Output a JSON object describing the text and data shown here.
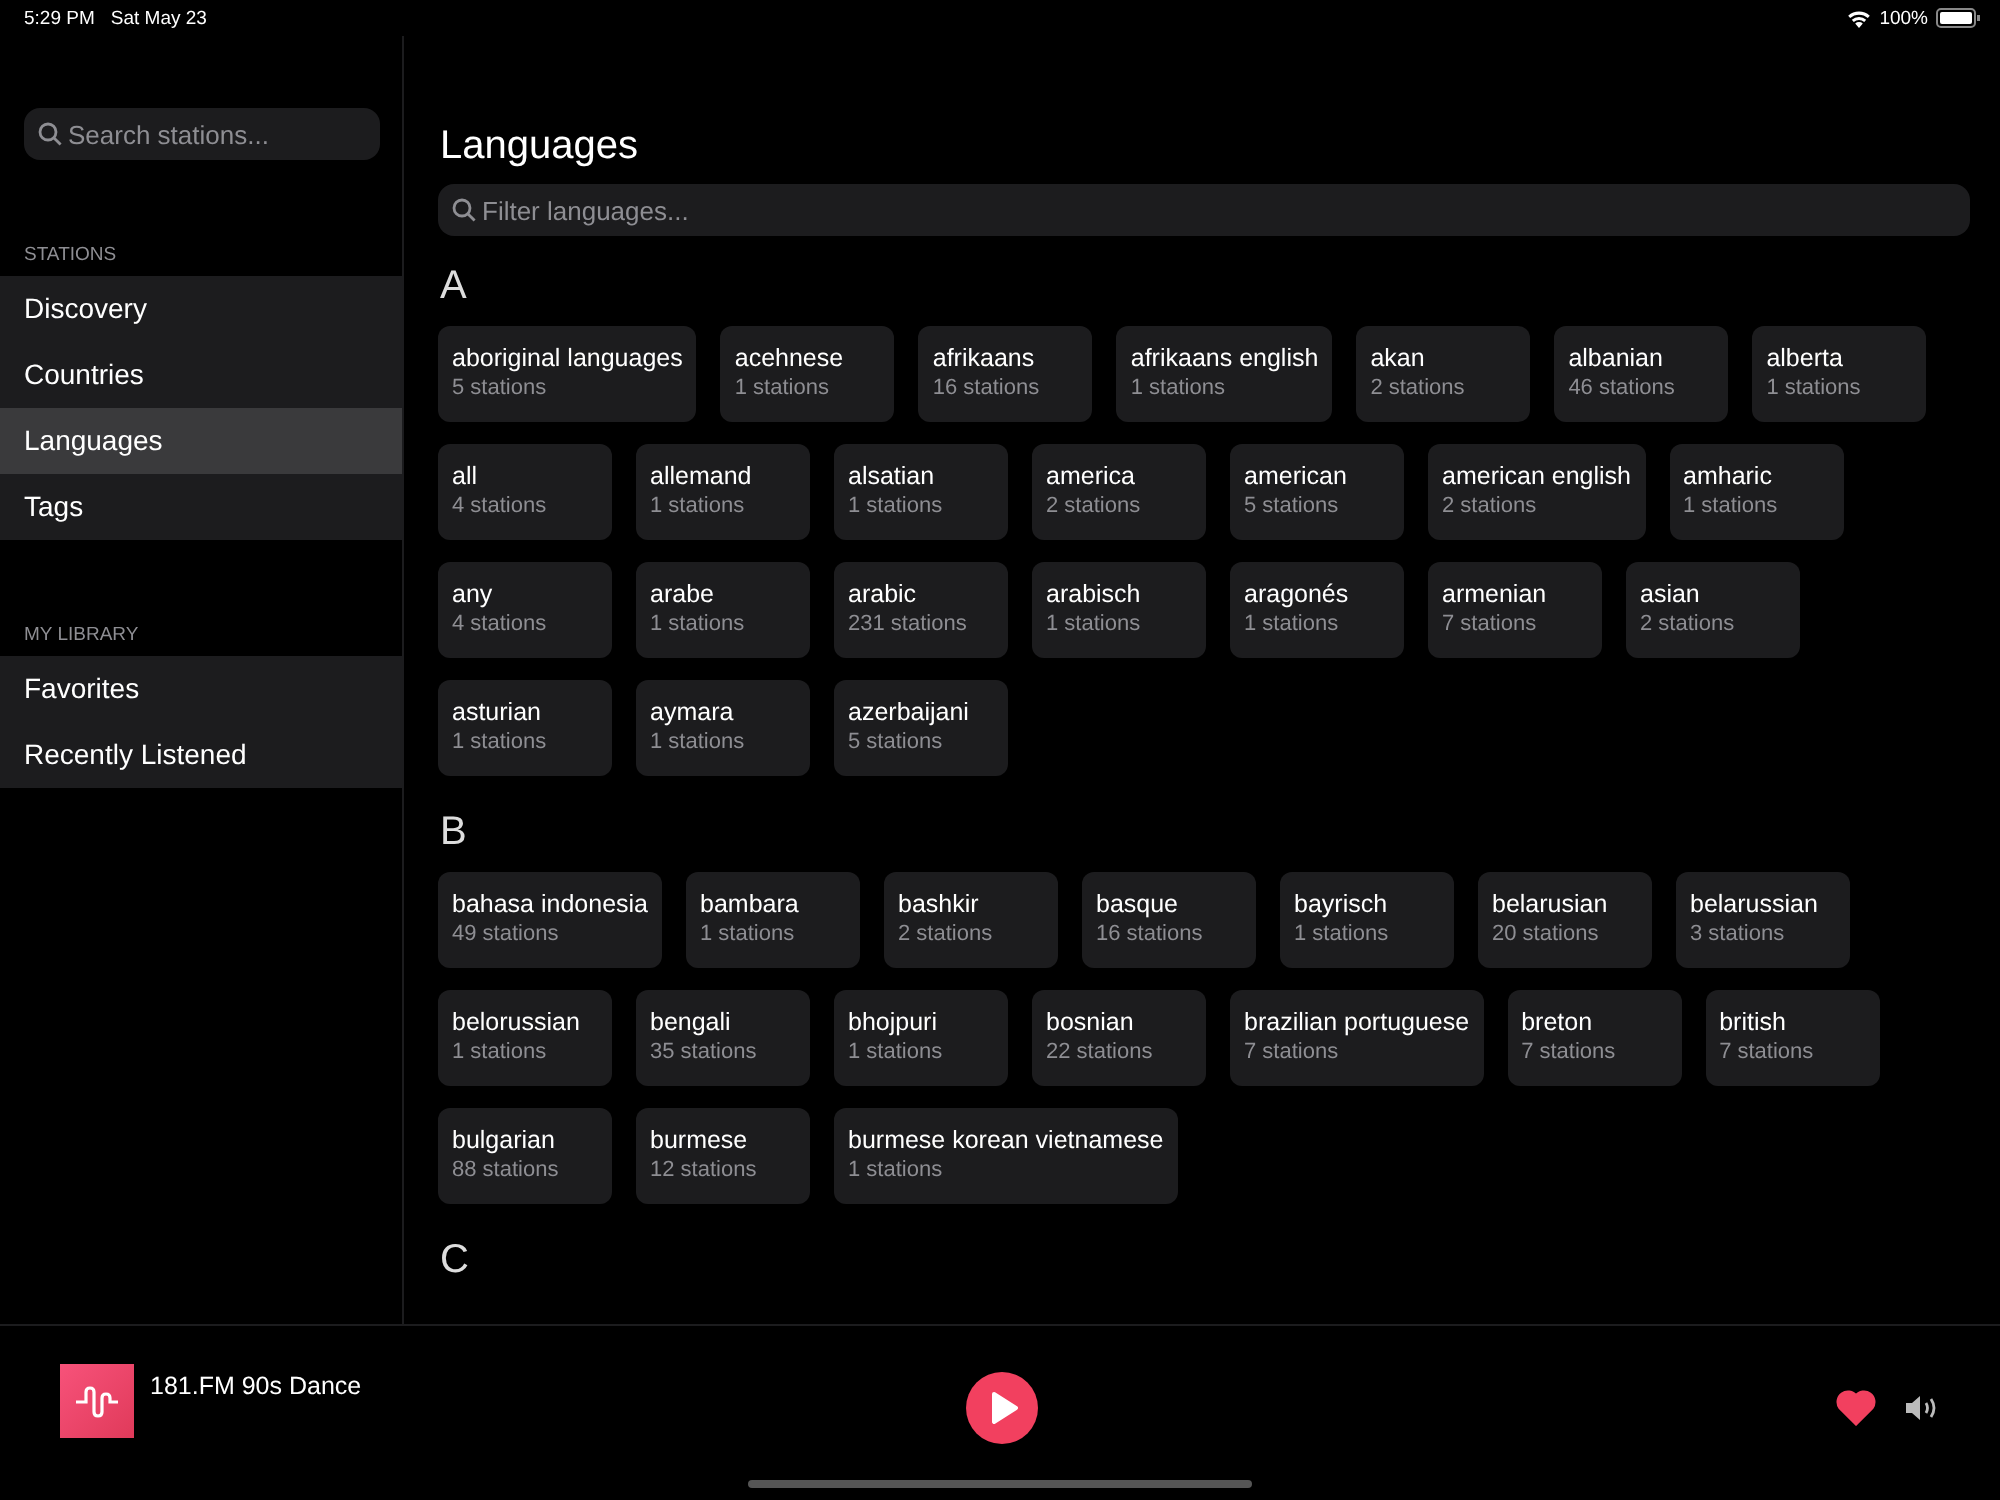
{
  "status_bar": {
    "time": "5:29 PM",
    "date": "Sat May 23",
    "battery": "100%"
  },
  "sidebar": {
    "search": {
      "placeholder": "Search stations..."
    },
    "sections": [
      {
        "title": "STATIONS",
        "items": [
          {
            "label": "Discovery",
            "selected": false
          },
          {
            "label": "Countries",
            "selected": false
          },
          {
            "label": "Languages",
            "selected": true
          },
          {
            "label": "Tags",
            "selected": false
          }
        ]
      },
      {
        "title": "MY LIBRARY",
        "items": [
          {
            "label": "Favorites",
            "selected": false
          },
          {
            "label": "Recently Listened",
            "selected": false
          }
        ]
      }
    ]
  },
  "main": {
    "title": "Languages",
    "filter": {
      "placeholder": "Filter languages..."
    },
    "groups": [
      {
        "letter": "A",
        "languages": [
          {
            "name": "aboriginal languages",
            "count": "5 stations"
          },
          {
            "name": "acehnese",
            "count": "1 stations"
          },
          {
            "name": "afrikaans",
            "count": "16 stations"
          },
          {
            "name": "afrikaans english",
            "count": "1 stations"
          },
          {
            "name": "akan",
            "count": "2 stations"
          },
          {
            "name": "albanian",
            "count": "46 stations"
          },
          {
            "name": "alberta",
            "count": "1 stations"
          },
          {
            "name": "all",
            "count": "4 stations"
          },
          {
            "name": "allemand",
            "count": "1 stations"
          },
          {
            "name": "alsatian",
            "count": "1 stations"
          },
          {
            "name": "america",
            "count": "2 stations"
          },
          {
            "name": "american",
            "count": "5 stations"
          },
          {
            "name": "american english",
            "count": "2 stations"
          },
          {
            "name": "amharic",
            "count": "1 stations"
          },
          {
            "name": "any",
            "count": "4 stations"
          },
          {
            "name": "arabe",
            "count": "1 stations"
          },
          {
            "name": "arabic",
            "count": "231 stations"
          },
          {
            "name": "arabisch",
            "count": "1 stations"
          },
          {
            "name": "aragonés",
            "count": "1 stations"
          },
          {
            "name": "armenian",
            "count": "7 stations"
          },
          {
            "name": "asian",
            "count": "2 stations"
          },
          {
            "name": "asturian",
            "count": "1 stations"
          },
          {
            "name": "aymara",
            "count": "1 stations"
          },
          {
            "name": "azerbaijani",
            "count": "5 stations"
          }
        ]
      },
      {
        "letter": "B",
        "languages": [
          {
            "name": "bahasa indonesia",
            "count": "49 stations"
          },
          {
            "name": "bambara",
            "count": "1 stations"
          },
          {
            "name": "bashkir",
            "count": "2 stations"
          },
          {
            "name": "basque",
            "count": "16 stations"
          },
          {
            "name": "bayrisch",
            "count": "1 stations"
          },
          {
            "name": "belarusian",
            "count": "20 stations"
          },
          {
            "name": "belarussian",
            "count": "3 stations"
          },
          {
            "name": "belorussian",
            "count": "1 stations"
          },
          {
            "name": "bengali",
            "count": "35 stations"
          },
          {
            "name": "bhojpuri",
            "count": "1 stations"
          },
          {
            "name": "bosnian",
            "count": "22 stations"
          },
          {
            "name": "brazilian portuguese",
            "count": "7 stations"
          },
          {
            "name": "breton",
            "count": "7 stations"
          },
          {
            "name": "british",
            "count": "7 stations"
          },
          {
            "name": "bulgarian",
            "count": "88 stations"
          },
          {
            "name": "burmese",
            "count": "12 stations"
          },
          {
            "name": "burmese korean vietnamese",
            "count": "1 stations"
          }
        ]
      },
      {
        "letter": "C"
      }
    ]
  },
  "player": {
    "station": "181.FM 90s Dance",
    "favorite": true
  }
}
